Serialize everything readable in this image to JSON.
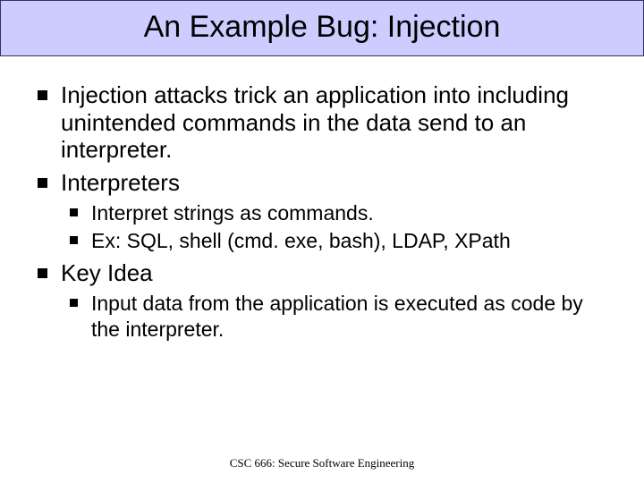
{
  "title": "An Example Bug: Injection",
  "bullets": {
    "b1": "Injection attacks trick an application into including unintended commands in the data send to an interpreter.",
    "b2": "Interpreters",
    "b2_1": "Interpret strings as commands.",
    "b2_2": "Ex: SQL, shell (cmd. exe, bash), LDAP, XPath",
    "b3": "Key Idea",
    "b3_1": "Input data from the application is executed as code by the interpreter."
  },
  "footer": "CSC 666: Secure Software Engineering"
}
